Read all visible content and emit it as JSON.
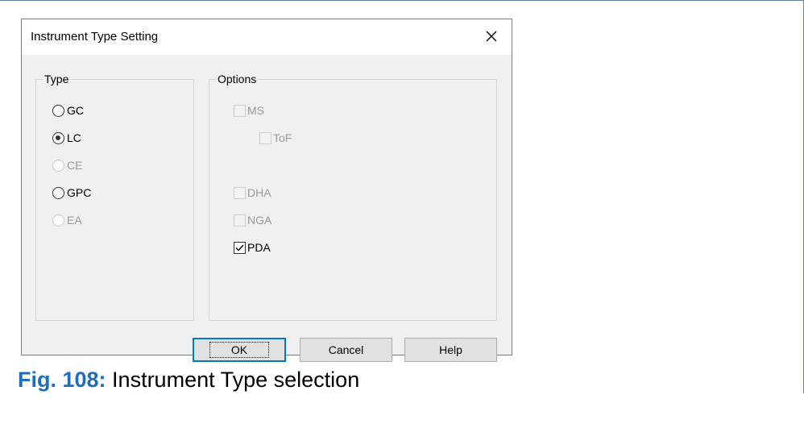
{
  "dialog": {
    "title": "Instrument Type Setting",
    "close_icon": "close-icon"
  },
  "type_group": {
    "label": "Type",
    "options": [
      {
        "label": "GC",
        "checked": false,
        "enabled": true
      },
      {
        "label": "LC",
        "checked": true,
        "enabled": true
      },
      {
        "label": "CE",
        "checked": false,
        "enabled": false
      },
      {
        "label": "GPC",
        "checked": false,
        "enabled": true
      },
      {
        "label": "EA",
        "checked": false,
        "enabled": false
      }
    ]
  },
  "options_group": {
    "label": "Options",
    "items": [
      {
        "label": "MS",
        "checked": false,
        "enabled": false
      },
      {
        "label": "ToF",
        "checked": false,
        "enabled": false
      },
      {
        "label": "DHA",
        "checked": false,
        "enabled": false
      },
      {
        "label": "NGA",
        "checked": false,
        "enabled": false
      },
      {
        "label": "PDA",
        "checked": true,
        "enabled": true
      }
    ]
  },
  "buttons": {
    "ok": "OK",
    "cancel": "Cancel",
    "help": "Help"
  },
  "caption": {
    "fig": "Fig. 108:",
    "text": "Instrument Type selection"
  },
  "colors": {
    "accent": "#0078d7",
    "caption_blue": "#1e6fb8",
    "dialog_bg": "#f0f0f0"
  }
}
